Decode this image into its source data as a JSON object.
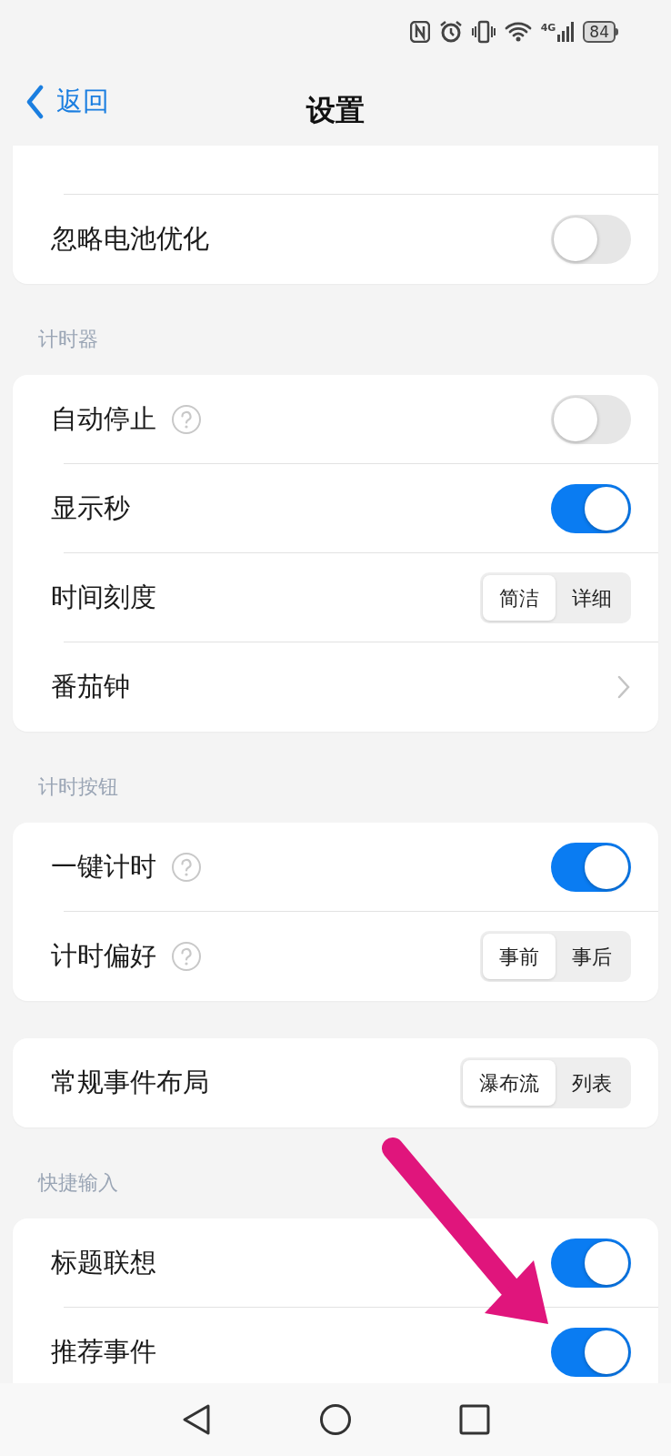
{
  "status_bar": {
    "network": "4G",
    "battery": "84"
  },
  "header": {
    "back": "返回",
    "title": "设置"
  },
  "sections": [
    {
      "rows": [
        {
          "kind": "toggle",
          "label": "忽略电池优化",
          "on": false
        }
      ]
    },
    {
      "title": "计时器",
      "rows": [
        {
          "kind": "toggle",
          "label": "自动停止",
          "help": true,
          "on": false
        },
        {
          "kind": "toggle",
          "label": "显示秒",
          "on": true
        },
        {
          "kind": "segmented",
          "label": "时间刻度",
          "options": [
            {
              "label": "简洁",
              "selected": true
            },
            {
              "label": "详细",
              "selected": false
            }
          ]
        },
        {
          "kind": "link",
          "label": "番茄钟"
        }
      ]
    },
    {
      "title": "计时按钮",
      "rows": [
        {
          "kind": "toggle",
          "label": "一键计时",
          "help": true,
          "on": true
        },
        {
          "kind": "segmented",
          "label": "计时偏好",
          "help": true,
          "options": [
            {
              "label": "事前",
              "selected": true
            },
            {
              "label": "事后",
              "selected": false
            }
          ]
        }
      ]
    },
    {
      "rows": [
        {
          "kind": "segmented",
          "label": "常规事件布局",
          "options": [
            {
              "label": "瀑布流",
              "selected": true
            },
            {
              "label": "列表",
              "selected": false
            }
          ]
        }
      ]
    },
    {
      "title": "快捷输入",
      "rows": [
        {
          "kind": "toggle",
          "label": "标题联想",
          "on": true
        },
        {
          "kind": "toggle",
          "label": "推荐事件",
          "on": true
        }
      ]
    }
  ]
}
